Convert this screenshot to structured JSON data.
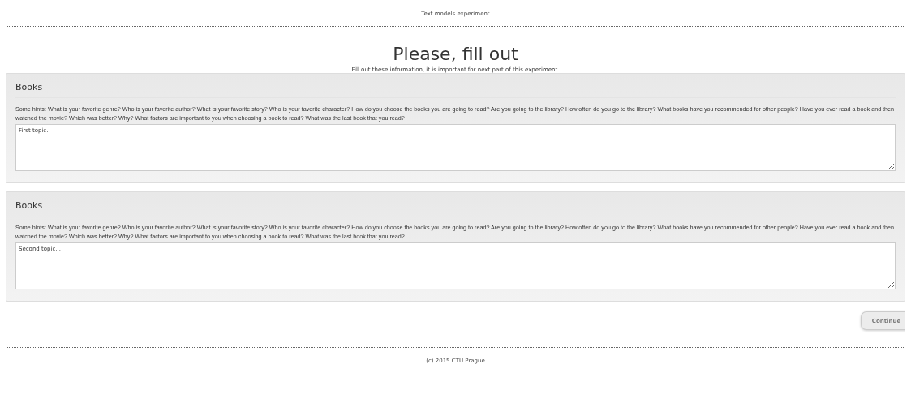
{
  "header": {
    "title": "Text models experiment"
  },
  "heading": "Please, fill out",
  "subheading": "Fill out these information, it is important for next part of this experiment.",
  "panels": [
    {
      "title": "Books",
      "hints": "Some hints: What is your favorite genre? Who is your favorite author? What is your favorite story? Who is your favorite character? How do you choose the books you are going to read? Are you going to the library? How often do you go to the library? What books have you recommended for other people? Have you ever read a book and then watched the movie? Which was better? Why? What factors are important to you when choosing a book to read? What was the last book that you read?",
      "value": "First topic.."
    },
    {
      "title": "Books",
      "hints": "Some hints: What is your favorite genre? Who is your favorite author? What is your favorite story? Who is your favorite character? How do you choose the books you are going to read? Are you going to the library? How often do you go to the library? What books have you recommended for other people? Have you ever read a book and then watched the movie? Which was better? Why? What factors are important to you when choosing a book to read? What was the last book that you read?",
      "value": "Second topic..."
    }
  ],
  "continue_button": "Continue",
  "footer": "(c) 2015 CTU Prague"
}
